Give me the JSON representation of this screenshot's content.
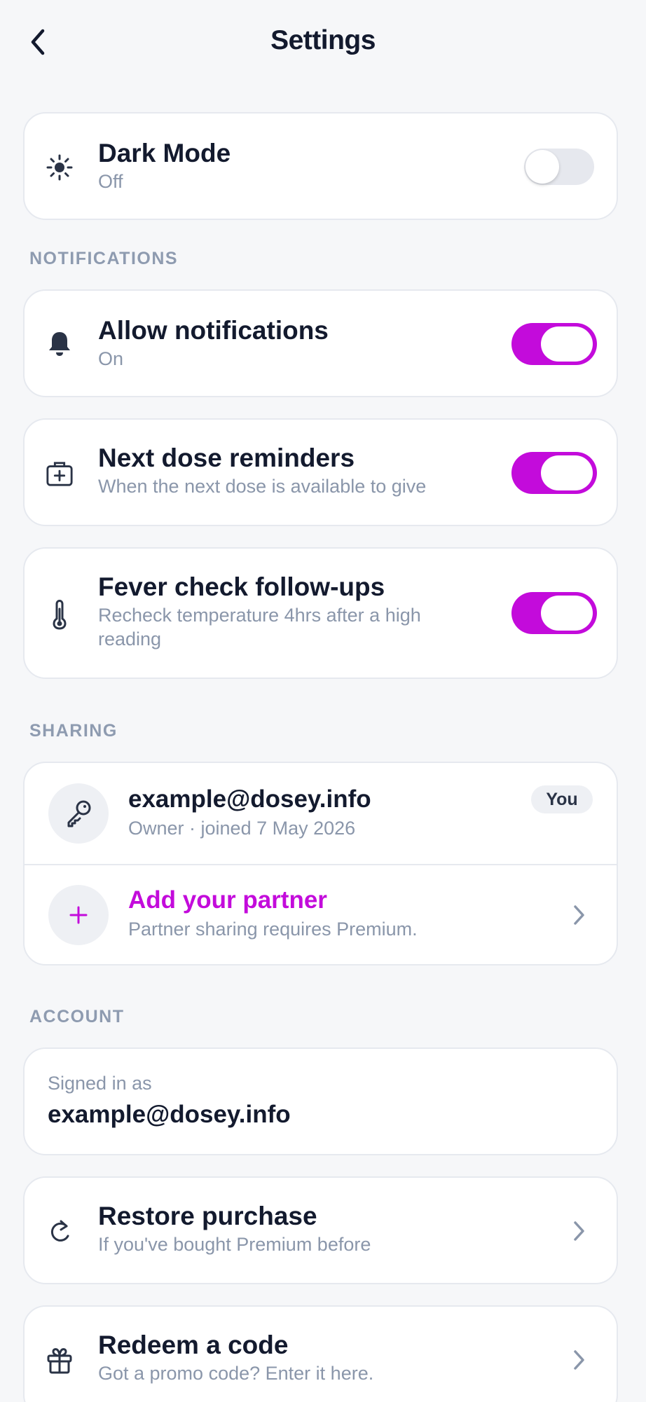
{
  "header": {
    "title": "Settings",
    "back_icon": "chevron-left-icon"
  },
  "appearance": {
    "title": "Dark Mode",
    "status": "Off",
    "enabled": false,
    "icon": "sun-icon"
  },
  "sections": {
    "notifications": "NOTIFICATIONS",
    "sharing": "SHARING",
    "account": "ACCOUNT"
  },
  "notifications": {
    "allow": {
      "title": "Allow notifications",
      "status": "On",
      "enabled": true,
      "icon": "bell-icon"
    },
    "next_dose": {
      "title": "Next dose reminders",
      "subtitle": "When the next dose is available to give",
      "enabled": true,
      "icon": "medical-bag-icon"
    },
    "fever_check": {
      "title": "Fever check follow-ups",
      "subtitle_line1": "Recheck temperature 4hrs after a high",
      "subtitle_line2": "reading",
      "enabled": true,
      "icon": "thermometer-icon"
    }
  },
  "sharing": {
    "owner": {
      "email": "example@dosey.info",
      "subtitle": "Owner · joined 7 May 2026",
      "badge": "You",
      "icon": "key-icon"
    },
    "partner": {
      "title": "Add your partner",
      "subtitle": "Partner sharing requires Premium.",
      "icon": "plus-icon"
    }
  },
  "account": {
    "signed_in_label": "Signed in as",
    "email": "example@dosey.info",
    "restore": {
      "title": "Restore purchase",
      "subtitle": "If you've bought Premium before",
      "icon": "refresh-icon"
    },
    "redeem": {
      "title": "Redeem a code",
      "subtitle": "Got a promo code? Enter it here.",
      "icon": "gift-icon"
    }
  },
  "colors": {
    "accent": "#c30bdb",
    "background": "#f6f7f9",
    "text": "#131a2e",
    "muted": "#8a96aa"
  }
}
